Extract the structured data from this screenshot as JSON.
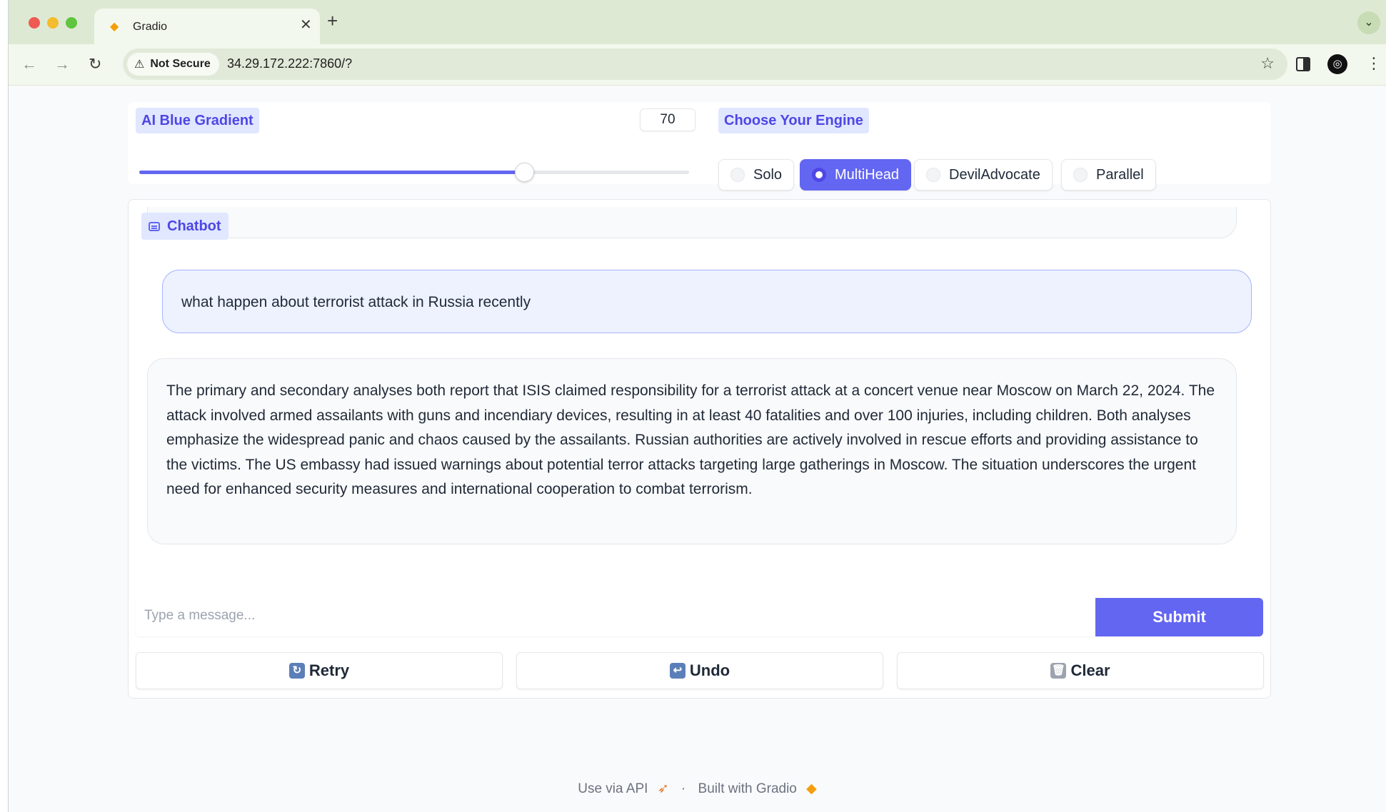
{
  "browser": {
    "tab_title": "Gradio",
    "tab_icon": "gradio-logo-icon",
    "security_label": "Not Secure",
    "url": "34.29.172.222:7860/?"
  },
  "controls": {
    "gradient_label": "AI Blue Gradient",
    "gradient_value": "70",
    "slider_fraction": 0.7,
    "engine_label": "Choose Your Engine",
    "engines": [
      {
        "label": "Solo",
        "selected": false
      },
      {
        "label": "MultiHead",
        "selected": true
      },
      {
        "label": "DevilAdvocate",
        "selected": false
      },
      {
        "label": "Parallel",
        "selected": false
      }
    ]
  },
  "chat": {
    "label": "Chatbot",
    "user_message": "what happen about terrorist attack in Russia recently",
    "bot_message": "The primary and secondary analyses both report that ISIS claimed responsibility for a terrorist attack at a concert venue near Moscow on March 22, 2024. The attack involved armed assailants with guns and incendiary devices, resulting in at least 40 fatalities and over 100 injuries, including children. Both analyses emphasize the widespread panic and chaos caused by the assailants. Russian authorities are actively involved in rescue efforts and providing assistance to the victims. The US embassy had issued warnings about potential terror attacks targeting large gatherings in Moscow. The situation underscores the urgent need for enhanced security measures and international cooperation to combat terrorism."
  },
  "composer": {
    "placeholder": "Type a message...",
    "submit_label": "Submit"
  },
  "actions": {
    "retry_label": "Retry",
    "undo_label": "Undo",
    "clear_label": "Clear"
  },
  "footer": {
    "api_label": "Use via API",
    "separator": "·",
    "built_label": "Built with Gradio"
  },
  "colors": {
    "accent": "#6366f1",
    "accent_light": "#e0e7ff",
    "browser_frame": "#dee9d4"
  }
}
